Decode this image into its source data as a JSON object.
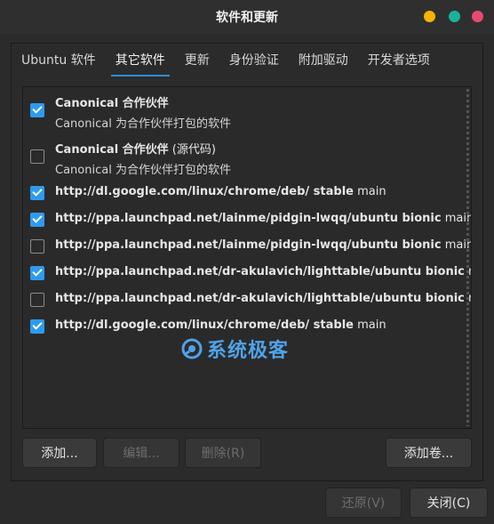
{
  "window": {
    "title": "软件和更新"
  },
  "window_controls": [
    {
      "name": "minimize-button",
      "color": "#f4b400"
    },
    {
      "name": "maximize-button",
      "color": "#19b39a"
    },
    {
      "name": "close-button",
      "color": "#e84a6f"
    }
  ],
  "tabs": [
    {
      "label": "Ubuntu 软件",
      "active": false
    },
    {
      "label": "其它软件",
      "active": true
    },
    {
      "label": "更新",
      "active": false
    },
    {
      "label": "身份验证",
      "active": false
    },
    {
      "label": "附加驱动",
      "active": false
    },
    {
      "label": "开发者选项",
      "active": false
    }
  ],
  "sources": [
    {
      "checked": true,
      "title_bold": "Canonical 合作伙伴",
      "title_extra": "",
      "subtitle": "Canonical 为合作伙伴打包的软件"
    },
    {
      "checked": false,
      "title_bold": "Canonical 合作伙伴",
      "title_extra": " (源代码)",
      "subtitle": "Canonical 为合作伙伴打包的软件"
    },
    {
      "checked": true,
      "title_bold": "http://dl.google.com/linux/chrome/deb/ stable",
      "title_extra": " main",
      "subtitle": ""
    },
    {
      "checked": true,
      "title_bold": "http://ppa.launchpad.net/lainme/pidgin-lwqq/ubuntu bionic",
      "title_extra": " main",
      "subtitle": ""
    },
    {
      "checked": false,
      "title_bold": "http://ppa.launchpad.net/lainme/pidgin-lwqq/ubuntu bionic",
      "title_extra": " main",
      "subtitle": ""
    },
    {
      "checked": true,
      "title_bold": "http://ppa.launchpad.net/dr-akulavich/lighttable/ubuntu bionic",
      "title_extra": " main",
      "subtitle": ""
    },
    {
      "checked": false,
      "title_bold": "http://ppa.launchpad.net/dr-akulavich/lighttable/ubuntu bionic",
      "title_extra": " main",
      "subtitle": ""
    },
    {
      "checked": true,
      "title_bold": "http://dl.google.com/linux/chrome/deb/ stable",
      "title_extra": " main",
      "subtitle": ""
    }
  ],
  "watermark": {
    "text": "系统极客",
    "color": "#4fa3e8"
  },
  "buttons": {
    "add": "添加...",
    "edit": "编辑...",
    "remove": "删除(R)",
    "add_volume": "添加卷...",
    "revert": "还原(V)",
    "close": "关闭(C)"
  },
  "accent_color": "#2b8ee0"
}
